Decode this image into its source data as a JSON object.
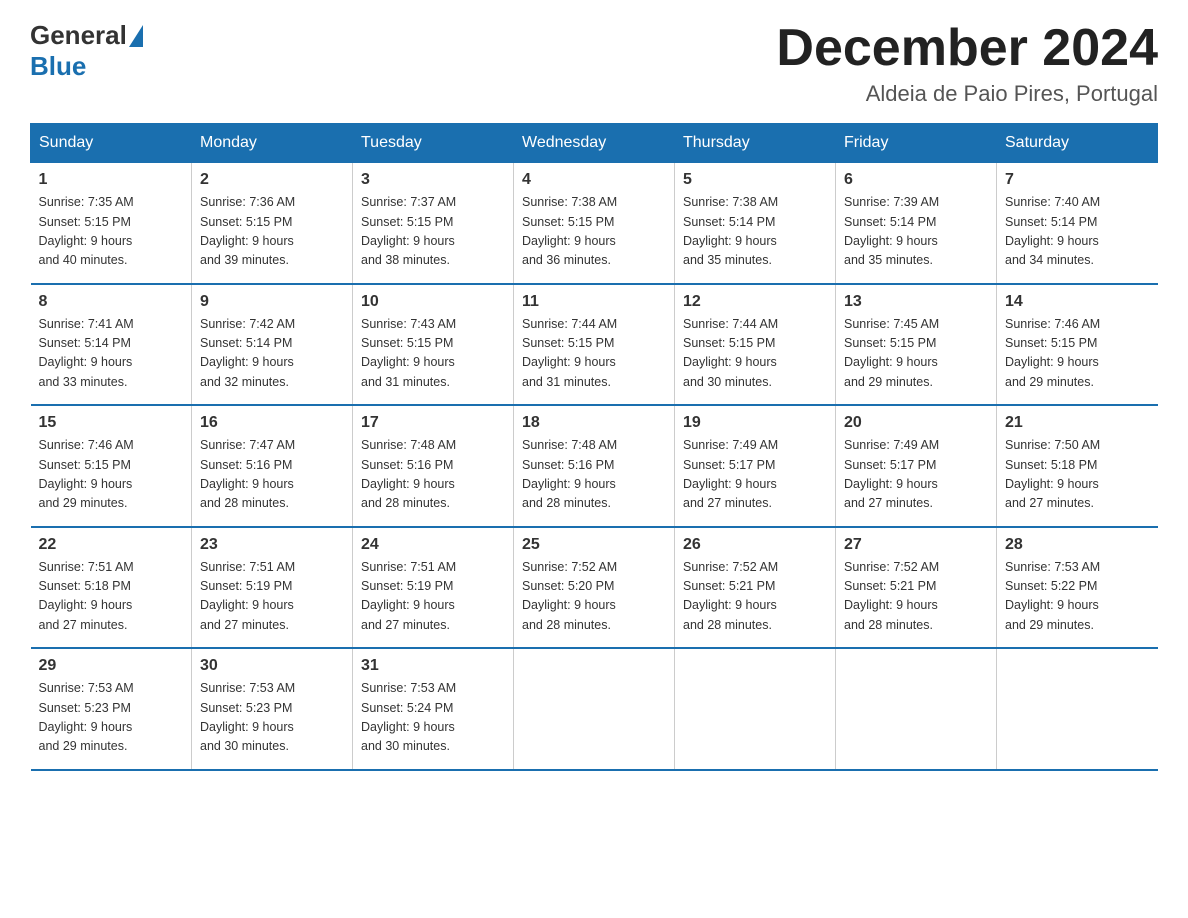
{
  "header": {
    "logo_general": "General",
    "logo_blue": "Blue",
    "month_year": "December 2024",
    "location": "Aldeia de Paio Pires, Portugal"
  },
  "weekdays": [
    "Sunday",
    "Monday",
    "Tuesday",
    "Wednesday",
    "Thursday",
    "Friday",
    "Saturday"
  ],
  "weeks": [
    [
      {
        "day": "1",
        "sunrise": "7:35 AM",
        "sunset": "5:15 PM",
        "daylight": "9 hours and 40 minutes."
      },
      {
        "day": "2",
        "sunrise": "7:36 AM",
        "sunset": "5:15 PM",
        "daylight": "9 hours and 39 minutes."
      },
      {
        "day": "3",
        "sunrise": "7:37 AM",
        "sunset": "5:15 PM",
        "daylight": "9 hours and 38 minutes."
      },
      {
        "day": "4",
        "sunrise": "7:38 AM",
        "sunset": "5:15 PM",
        "daylight": "9 hours and 36 minutes."
      },
      {
        "day": "5",
        "sunrise": "7:38 AM",
        "sunset": "5:14 PM",
        "daylight": "9 hours and 35 minutes."
      },
      {
        "day": "6",
        "sunrise": "7:39 AM",
        "sunset": "5:14 PM",
        "daylight": "9 hours and 35 minutes."
      },
      {
        "day": "7",
        "sunrise": "7:40 AM",
        "sunset": "5:14 PM",
        "daylight": "9 hours and 34 minutes."
      }
    ],
    [
      {
        "day": "8",
        "sunrise": "7:41 AM",
        "sunset": "5:14 PM",
        "daylight": "9 hours and 33 minutes."
      },
      {
        "day": "9",
        "sunrise": "7:42 AM",
        "sunset": "5:14 PM",
        "daylight": "9 hours and 32 minutes."
      },
      {
        "day": "10",
        "sunrise": "7:43 AM",
        "sunset": "5:15 PM",
        "daylight": "9 hours and 31 minutes."
      },
      {
        "day": "11",
        "sunrise": "7:44 AM",
        "sunset": "5:15 PM",
        "daylight": "9 hours and 31 minutes."
      },
      {
        "day": "12",
        "sunrise": "7:44 AM",
        "sunset": "5:15 PM",
        "daylight": "9 hours and 30 minutes."
      },
      {
        "day": "13",
        "sunrise": "7:45 AM",
        "sunset": "5:15 PM",
        "daylight": "9 hours and 29 minutes."
      },
      {
        "day": "14",
        "sunrise": "7:46 AM",
        "sunset": "5:15 PM",
        "daylight": "9 hours and 29 minutes."
      }
    ],
    [
      {
        "day": "15",
        "sunrise": "7:46 AM",
        "sunset": "5:15 PM",
        "daylight": "9 hours and 29 minutes."
      },
      {
        "day": "16",
        "sunrise": "7:47 AM",
        "sunset": "5:16 PM",
        "daylight": "9 hours and 28 minutes."
      },
      {
        "day": "17",
        "sunrise": "7:48 AM",
        "sunset": "5:16 PM",
        "daylight": "9 hours and 28 minutes."
      },
      {
        "day": "18",
        "sunrise": "7:48 AM",
        "sunset": "5:16 PM",
        "daylight": "9 hours and 28 minutes."
      },
      {
        "day": "19",
        "sunrise": "7:49 AM",
        "sunset": "5:17 PM",
        "daylight": "9 hours and 27 minutes."
      },
      {
        "day": "20",
        "sunrise": "7:49 AM",
        "sunset": "5:17 PM",
        "daylight": "9 hours and 27 minutes."
      },
      {
        "day": "21",
        "sunrise": "7:50 AM",
        "sunset": "5:18 PM",
        "daylight": "9 hours and 27 minutes."
      }
    ],
    [
      {
        "day": "22",
        "sunrise": "7:51 AM",
        "sunset": "5:18 PM",
        "daylight": "9 hours and 27 minutes."
      },
      {
        "day": "23",
        "sunrise": "7:51 AM",
        "sunset": "5:19 PM",
        "daylight": "9 hours and 27 minutes."
      },
      {
        "day": "24",
        "sunrise": "7:51 AM",
        "sunset": "5:19 PM",
        "daylight": "9 hours and 27 minutes."
      },
      {
        "day": "25",
        "sunrise": "7:52 AM",
        "sunset": "5:20 PM",
        "daylight": "9 hours and 28 minutes."
      },
      {
        "day": "26",
        "sunrise": "7:52 AM",
        "sunset": "5:21 PM",
        "daylight": "9 hours and 28 minutes."
      },
      {
        "day": "27",
        "sunrise": "7:52 AM",
        "sunset": "5:21 PM",
        "daylight": "9 hours and 28 minutes."
      },
      {
        "day": "28",
        "sunrise": "7:53 AM",
        "sunset": "5:22 PM",
        "daylight": "9 hours and 29 minutes."
      }
    ],
    [
      {
        "day": "29",
        "sunrise": "7:53 AM",
        "sunset": "5:23 PM",
        "daylight": "9 hours and 29 minutes."
      },
      {
        "day": "30",
        "sunrise": "7:53 AM",
        "sunset": "5:23 PM",
        "daylight": "9 hours and 30 minutes."
      },
      {
        "day": "31",
        "sunrise": "7:53 AM",
        "sunset": "5:24 PM",
        "daylight": "9 hours and 30 minutes."
      },
      null,
      null,
      null,
      null
    ]
  ],
  "labels": {
    "sunrise": "Sunrise:",
    "sunset": "Sunset:",
    "daylight": "Daylight:"
  }
}
